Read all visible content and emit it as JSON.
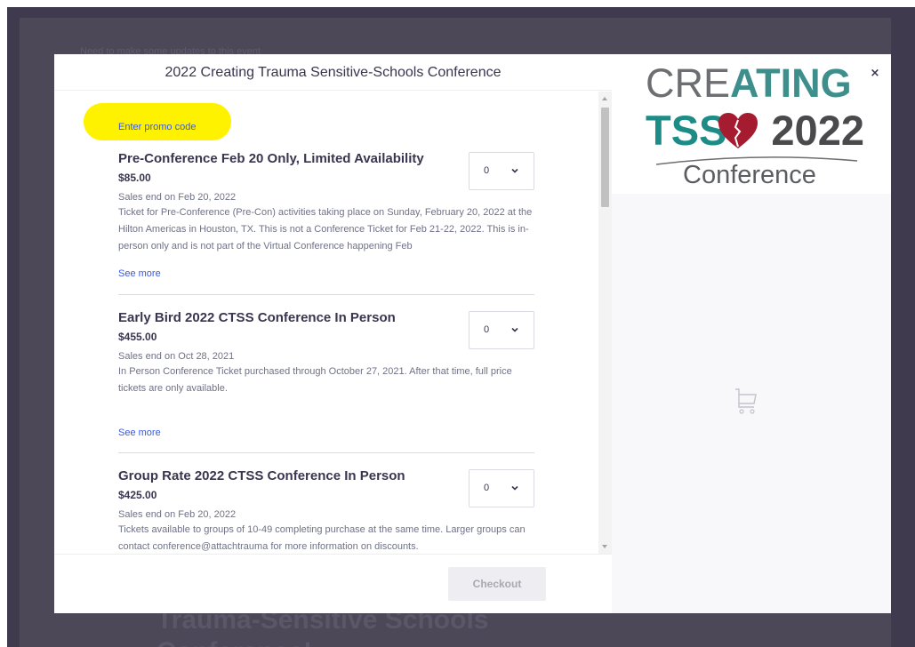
{
  "background": {
    "top_text": "Need to make some updates to this event",
    "heading": "Trauma-Sensitive Schools Conference!"
  },
  "modal": {
    "title": "2022 Creating Trauma Sensitive-Schools Conference",
    "promo_link": "Enter promo code",
    "see_more_label": "See more",
    "tickets": [
      {
        "name": "Pre-Conference Feb 20 Only, Limited Availability",
        "price": "$85.00",
        "sales_end": "Sales end on Feb 20, 2022",
        "description": "Ticket for Pre-Conference (Pre-Con) activities taking place on Sunday, February 20, 2022 at the Hilton Americas in Houston, TX.  This is not a Conference Ticket for Feb 21-22, 2022.  This is in-person only and is not part of the Virtual Conference happening Feb",
        "quantity": "0"
      },
      {
        "name": "Early Bird 2022 CTSS Conference In Person",
        "price": "$455.00",
        "sales_end": "Sales end on Oct 28, 2021",
        "description": "In Person Conference Ticket purchased through October 27, 2021.  After that time, full price tickets are only available.",
        "quantity": "0"
      },
      {
        "name": "Group Rate 2022 CTSS Conference In Person",
        "price": "$425.00",
        "sales_end": "Sales end on Feb 20, 2022",
        "description": "Tickets available to groups of 10-49 completing purchase at the same time.  Larger groups can contact conference@attachtrauma for more information on discounts.",
        "quantity": "0"
      }
    ],
    "checkout_label": "Checkout",
    "close_glyph": "×"
  },
  "logo": {
    "line1_grey": "CRE",
    "line1_teal": "ATING",
    "line2_teal": "TSS",
    "line2_year": "2022",
    "line3": "Conference"
  },
  "icons": {
    "cart": "shopping-cart-icon",
    "chevron": "chevron-down-icon",
    "heart": "broken-heart-icon"
  },
  "colors": {
    "link": "#3659e3",
    "teal": "#1d8c86",
    "heart": "#a51c30",
    "highlight": "#fff200"
  }
}
